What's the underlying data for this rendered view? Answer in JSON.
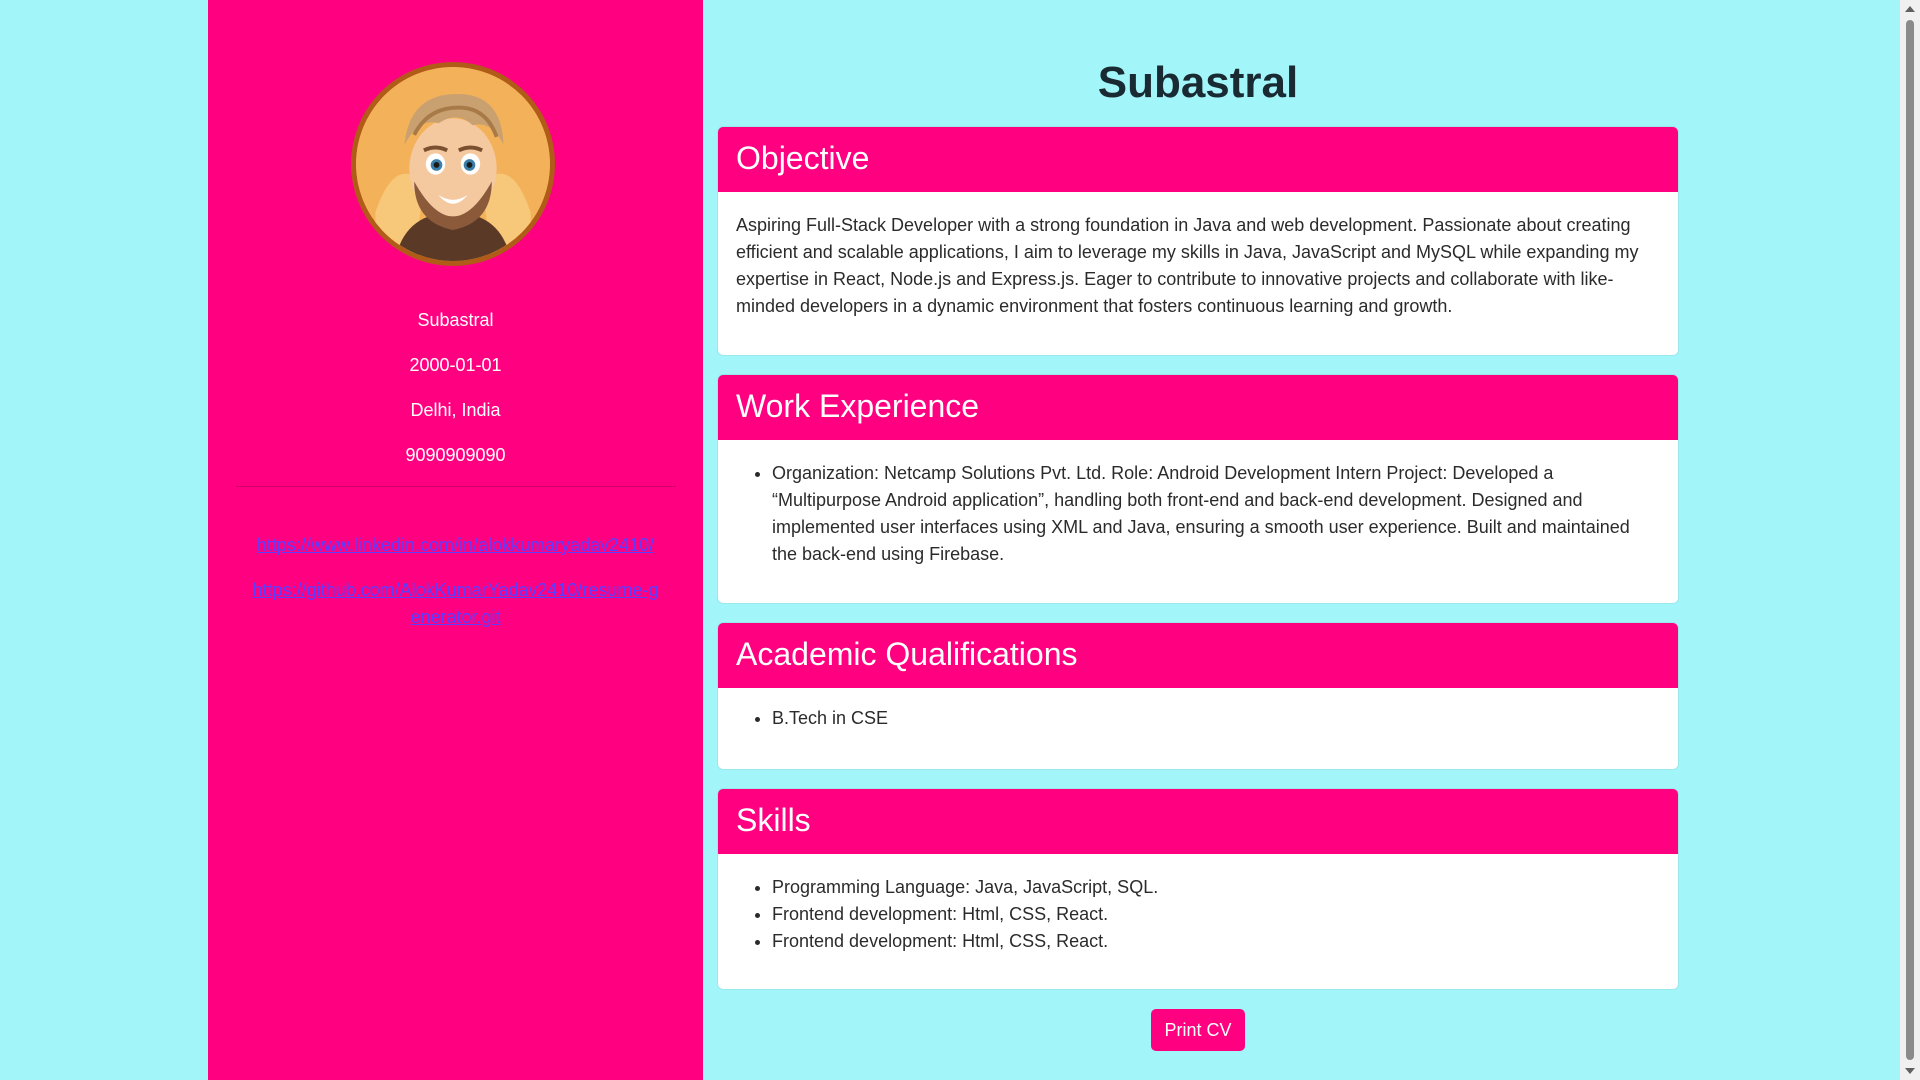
{
  "profile": {
    "avatar_icon": "cartoon-avatar",
    "name": "Subastral",
    "dob": "2000-01-01",
    "location": "Delhi, India",
    "phone": "9090909090",
    "links": [
      "https://www.linkedin.com/in/alokkumaryadav2410/",
      "https://github.com/AlokKumarYadav2410/resume-generator.git"
    ]
  },
  "main": {
    "title": "Subastral",
    "objective": {
      "heading": "Objective",
      "text": "Aspiring Full-Stack Developer with a strong foundation in Java and web development. Passionate about creating efficient and scalable applications, I aim to leverage my skills in Java, JavaScript and MySQL while expanding my expertise in React, Node.js and Express.js. Eager to contribute to innovative projects and collaborate with like-minded developers in a dynamic environment that fosters continuous learning and growth."
    },
    "work": {
      "heading": "Work Experience",
      "items": [
        "Organization: Netcamp Solutions Pvt. Ltd. Role: Android Development Intern Project: Developed a “Multipurpose Android application”, handling both front-end and back-end development. Designed and implemented user interfaces using XML and Java, ensuring a smooth user experience. Built and maintained the back-end using Firebase."
      ]
    },
    "academic": {
      "heading": "Academic Qualifications",
      "items": [
        "B.Tech in CSE"
      ]
    },
    "skills": {
      "heading": "Skills",
      "items": [
        "Programming Language: Java, JavaScript, SQL.",
        "Frontend development: Html, CSS, React.",
        "Frontend development: Html, CSS, React."
      ]
    },
    "print_label": "Print CV"
  },
  "colors": {
    "background": "#a2f5f9",
    "accent": "#ff0080",
    "link": "#5b3fff"
  }
}
